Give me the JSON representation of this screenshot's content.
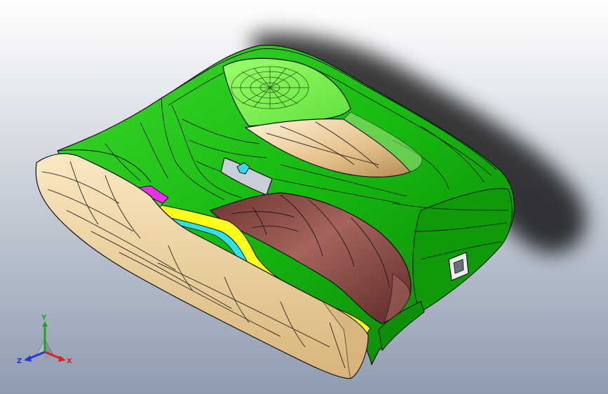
{
  "viewport": {
    "background_top": "#ffffff",
    "background_bottom": "#8f9cb0"
  },
  "colors": {
    "shell_green": "#16b90f",
    "shell_green_light": "#3fd92e",
    "shell_green_dark": "#0c7f07",
    "panel_lime": "#7bf34a",
    "beige": "#f2d9a5",
    "beige_shadow": "#c9a56e",
    "maroon": "#8b4f4a",
    "maroon_dark": "#5c2a27",
    "yellow": "#ffff1a",
    "cyan": "#2fe0ea",
    "magenta": "#e733e6",
    "edge_line": "#101010"
  },
  "triad": {
    "x_label": "X",
    "y_label": "Y",
    "z_label": "Z",
    "x_color": "#e02020",
    "y_color": "#1fa51f",
    "z_color": "#2535e0"
  }
}
